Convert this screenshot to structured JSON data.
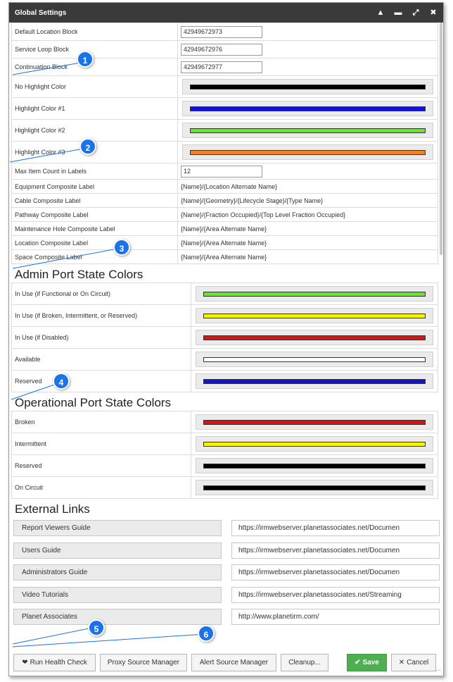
{
  "window": {
    "title": "Global Settings"
  },
  "settings": [
    {
      "label": "Default Location Block",
      "type": "input",
      "value": "42949672973"
    },
    {
      "label": "Service Loop Block",
      "type": "input",
      "value": "42949672976"
    },
    {
      "label": "Continuation Block",
      "type": "input",
      "value": "42949672977"
    },
    {
      "label": "No Highlight Color",
      "type": "color",
      "color": "#000000"
    },
    {
      "label": "Highlight Color #1",
      "type": "color",
      "color": "#1010e0"
    },
    {
      "label": "Highlight Color #2",
      "type": "color",
      "color": "#66e82a"
    },
    {
      "label": "Highlight Color #3",
      "type": "color",
      "color": "#f58220"
    },
    {
      "label": "Max Item Count in Labels",
      "type": "input",
      "value": "12"
    },
    {
      "label": "Equipment Composite Label",
      "type": "text",
      "value": "{Name}/{Location Alternate Name}"
    },
    {
      "label": "Cable Composite Label",
      "type": "text",
      "value": "{Name}/{Geometry}/{Lifecycle Stage}/{Type Name}"
    },
    {
      "label": "Pathway Composite Label",
      "type": "text",
      "value": "{Name}/{Fraction Occupied}/{Top Level Fraction Occupied}"
    },
    {
      "label": "Maintenance Hole Composite Label",
      "type": "text",
      "value": "{Name}/{Area Alternate Name}"
    },
    {
      "label": "Location Composite Label",
      "type": "text",
      "value": "{Name}/{Area Alternate Name}"
    },
    {
      "label": "Space Composite Label",
      "type": "text",
      "value": "{Name}/{Area Alternate Name}"
    }
  ],
  "admin": {
    "heading": "Admin Port State Colors",
    "rows": [
      {
        "label": "In Use (if Functional or On Circuit)",
        "color": "#66e82a"
      },
      {
        "label": "In Use (if Broken, Intermittent, or Reserved)",
        "color": "#f5f500"
      },
      {
        "label": "In Use (if Disabled)",
        "color": "#e01010"
      },
      {
        "label": "Available",
        "color": "#ffffff"
      },
      {
        "label": "Reserved",
        "color": "#1010e0"
      }
    ]
  },
  "operational": {
    "heading": "Operational Port State Colors",
    "rows": [
      {
        "label": "Broken",
        "color": "#e01010"
      },
      {
        "label": "Intermittent",
        "color": "#f5f500"
      },
      {
        "label": "Reserved",
        "color": "#000000"
      },
      {
        "label": "On Circuit",
        "color": "#000000"
      }
    ]
  },
  "links": {
    "heading": "External Links",
    "items": [
      {
        "label": "Report Viewers Guide",
        "url": "https://irmwebserver.planetassociates.net/Documen"
      },
      {
        "label": "Users Guide",
        "url": "https://irmwebserver.planetassociates.net/Documen"
      },
      {
        "label": "Administrators Guide",
        "url": "https://irmwebserver.planetassociates.net/Documen"
      },
      {
        "label": "Video Tutorials",
        "url": "https://irmwebserver.planetassociates.net/Streaming"
      },
      {
        "label": "Planet Associates",
        "url": "http://www.planetirm.com/"
      }
    ]
  },
  "footer": {
    "health": "Run Health Check",
    "proxy": "Proxy Source Manager",
    "alert": "Alert Source Manager",
    "cleanup": "Cleanup...",
    "save": "Save",
    "cancel": "Cancel"
  },
  "callouts": [
    "1",
    "2",
    "3",
    "4",
    "5",
    "6"
  ]
}
